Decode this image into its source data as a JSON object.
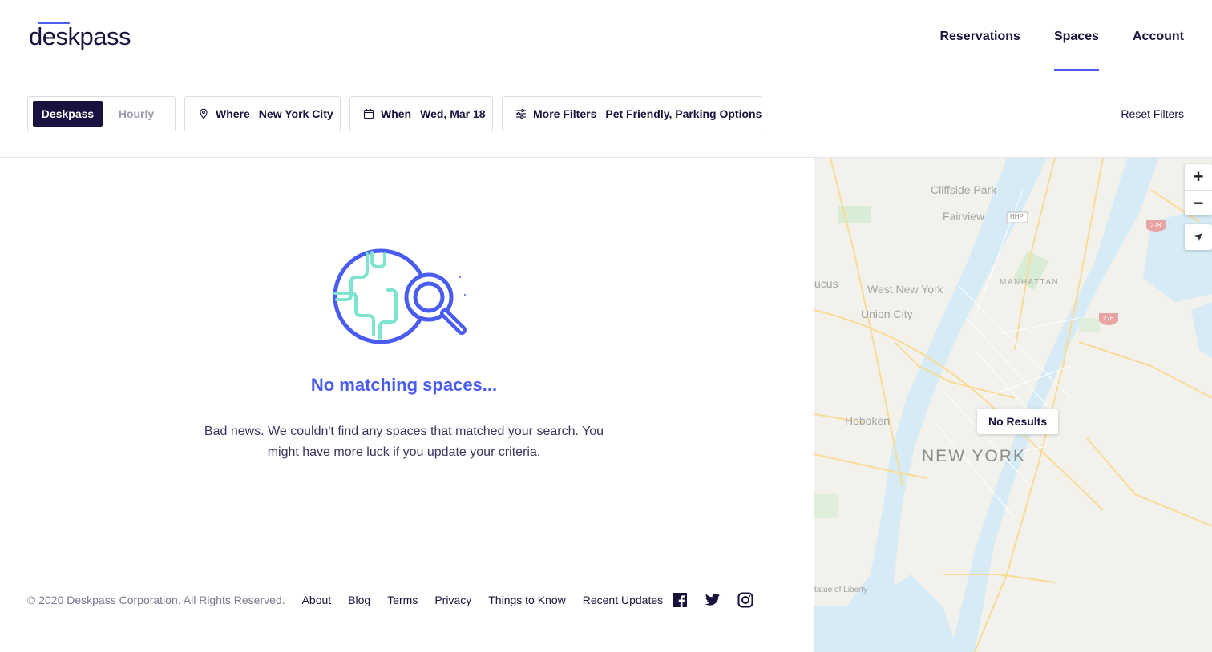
{
  "brand": {
    "logo_text": "deskpass",
    "accent": "#4a5cf0",
    "dark": "#18123e"
  },
  "nav": {
    "items": [
      {
        "label": "Reservations",
        "active": false
      },
      {
        "label": "Spaces",
        "active": true
      },
      {
        "label": "Account",
        "active": false
      }
    ]
  },
  "filters": {
    "mode_options": [
      "Deskpass",
      "Hourly"
    ],
    "mode_selected": "Deskpass",
    "where": {
      "label": "Where",
      "value": "New York City",
      "icon": "map-pin-icon"
    },
    "when": {
      "label": "When",
      "value": "Wed, Mar 18",
      "icon": "calendar-icon"
    },
    "more": {
      "label": "More Filters",
      "value": "Pet Friendly, Parking Options",
      "icon": "sliders-icon"
    },
    "reset_label": "Reset Filters"
  },
  "empty_state": {
    "illustration": "globe-search-icon",
    "title": "No matching spaces...",
    "body": "Bad news. We couldn't find any spaces that matched your search. You might have more luck if you update your criteria."
  },
  "footer": {
    "copyright": "© 2020 Deskpass Corporation. All Rights Reserved.",
    "links": [
      "About",
      "Blog",
      "Terms",
      "Privacy",
      "Things to Know",
      "Recent Updates"
    ],
    "social": [
      "facebook-icon",
      "twitter-icon",
      "instagram-icon"
    ]
  },
  "map": {
    "no_results_label": "No Results",
    "zoom_in": "+",
    "zoom_out": "−",
    "labels": [
      "Cliffside Park",
      "Fairview",
      "West New York",
      "Union City",
      "MANHATTAN",
      "Hoboken",
      "NEW YORK",
      "ucus",
      "tatue of Liberty",
      "HHP",
      "278",
      "278"
    ]
  }
}
